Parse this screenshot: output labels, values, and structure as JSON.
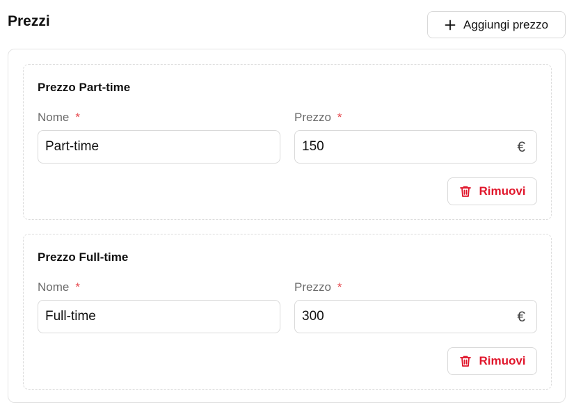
{
  "section": {
    "title": "Prezzi",
    "add_button_label": "Aggiungi prezzo"
  },
  "prices": [
    {
      "card_title": "Prezzo Part-time",
      "name_label": "Nome",
      "name_required": "*",
      "name_value": "Part-time",
      "price_label": "Prezzo",
      "price_required": "*",
      "price_value": "150",
      "currency_symbol": "€",
      "remove_label": "Rimuovi"
    },
    {
      "card_title": "Prezzo Full-time",
      "name_label": "Nome",
      "name_required": "*",
      "name_value": "Full-time",
      "price_label": "Prezzo",
      "price_required": "*",
      "price_value": "300",
      "currency_symbol": "€",
      "remove_label": "Rimuovi"
    }
  ],
  "colors": {
    "danger": "#e0162b",
    "required": "#e5484d",
    "border": "#d9d9d9"
  },
  "icons": {
    "add": "plus-icon",
    "remove": "trash-icon"
  }
}
